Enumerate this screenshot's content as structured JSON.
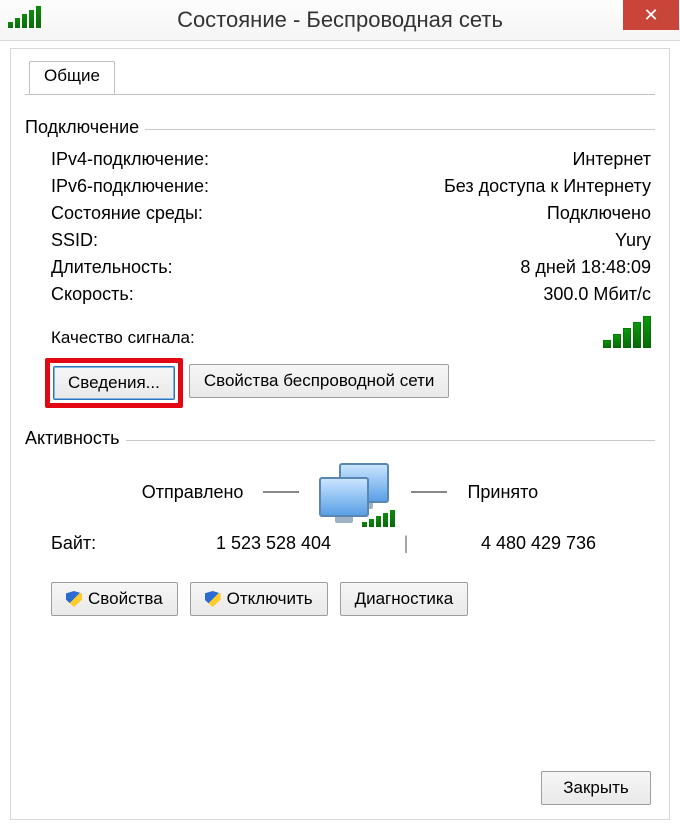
{
  "window": {
    "title": "Состояние - Беспроводная сеть"
  },
  "tab": {
    "general": "Общие"
  },
  "connection": {
    "legend": "Подключение",
    "ipv4_label": "IPv4-подключение:",
    "ipv4_value": "Интернет",
    "ipv6_label": "IPv6-подключение:",
    "ipv6_value": "Без доступа к Интернету",
    "media_label": "Состояние среды:",
    "media_value": "Подключено",
    "ssid_label": "SSID:",
    "ssid_value": "Yury",
    "duration_label": "Длительность:",
    "duration_value": "8 дней 18:48:09",
    "speed_label": "Скорость:",
    "speed_value": "300.0 Мбит/с",
    "signal_label": "Качество сигнала:"
  },
  "buttons": {
    "details": "Сведения...",
    "wireless_props": "Свойства беспроводной сети",
    "properties": "Свойства",
    "disable": "Отключить",
    "diagnose": "Диагностика",
    "close": "Закрыть"
  },
  "activity": {
    "legend": "Активность",
    "sent_label": "Отправлено",
    "recv_label": "Принято",
    "bytes_label": "Байт:",
    "bytes_sent": "1 523 528 404",
    "bytes_recv": "4 480 429 736"
  }
}
